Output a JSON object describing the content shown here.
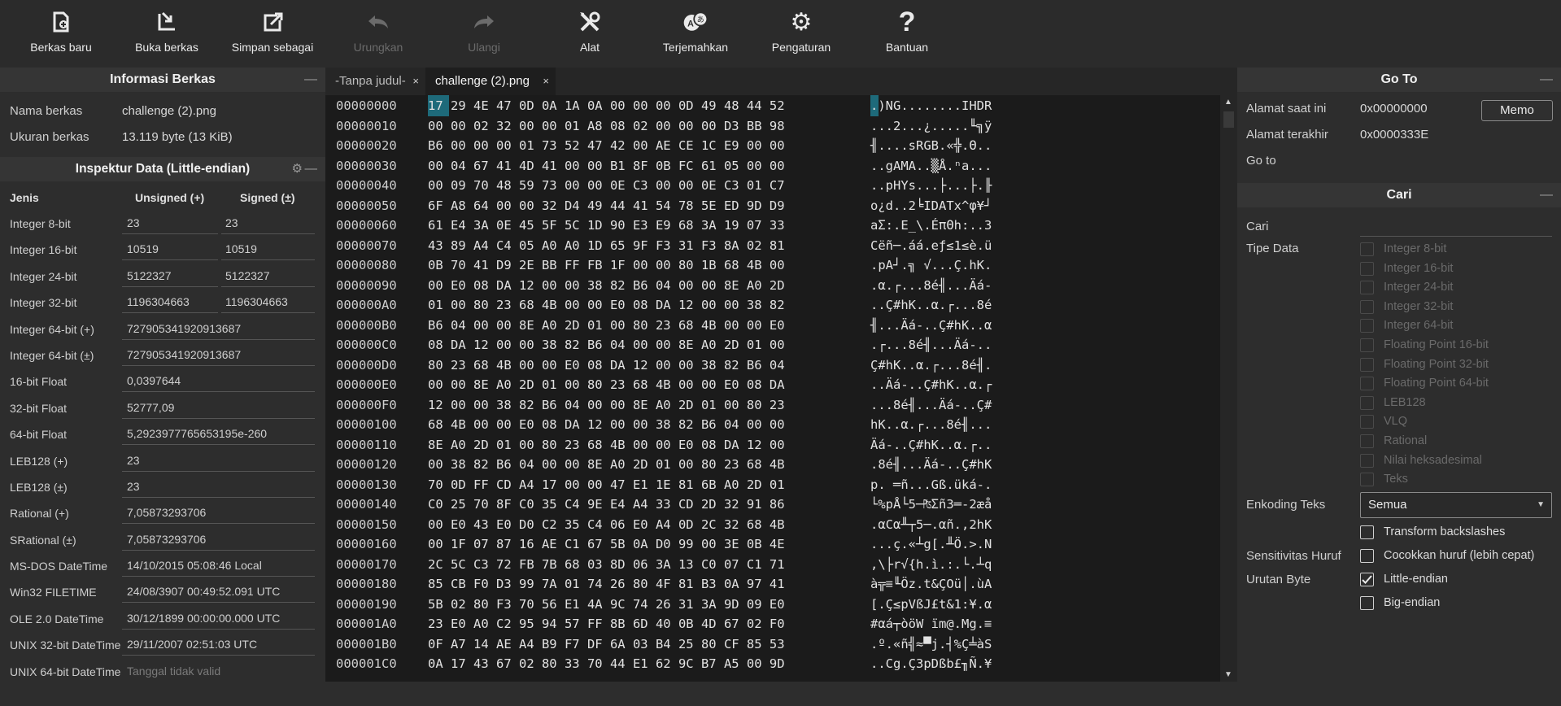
{
  "toolbar": {
    "new_file": "Berkas baru",
    "open_file": "Buka berkas",
    "save_as": "Simpan sebagai",
    "undo": "Urungkan",
    "redo": "Ulangi",
    "tools": "Alat",
    "translate": "Terjemahkan",
    "settings": "Pengaturan",
    "help": "Bantuan"
  },
  "file_info": {
    "title": "Informasi Berkas",
    "name_label": "Nama berkas",
    "name_value": "challenge (2).png",
    "size_label": "Ukuran berkas",
    "size_value": "13.119 byte (13 KiB)"
  },
  "inspector": {
    "title": "Inspektur Data (Little-endian)",
    "col_type": "Jenis",
    "col_unsigned": "Unsigned (+)",
    "col_signed": "Signed (±)",
    "rows": [
      {
        "label": "Integer 8-bit",
        "unsigned": "23",
        "signed": "23"
      },
      {
        "label": "Integer 16-bit",
        "unsigned": "10519",
        "signed": "10519"
      },
      {
        "label": "Integer 24-bit",
        "unsigned": "5122327",
        "signed": "5122327"
      },
      {
        "label": "Integer 32-bit",
        "unsigned": "1196304663",
        "signed": "1196304663"
      }
    ],
    "full_rows": [
      {
        "label": "Integer 64-bit (+)",
        "value": "727905341920913687"
      },
      {
        "label": "Integer 64-bit (±)",
        "value": "727905341920913687"
      },
      {
        "label": "16-bit Float",
        "value": "0,0397644"
      },
      {
        "label": "32-bit Float",
        "value": "52777,09"
      },
      {
        "label": "64-bit Float",
        "value": "5,2923977765653195e-260"
      },
      {
        "label": "LEB128 (+)",
        "value": "23"
      },
      {
        "label": "LEB128 (±)",
        "value": "23"
      },
      {
        "label": "Rational (+)",
        "value": "7,05873293706"
      },
      {
        "label": "SRational (±)",
        "value": "7,05873293706"
      },
      {
        "label": "MS-DOS DateTime",
        "value": "14/10/2015 05:08:46 Local"
      },
      {
        "label": "Win32 FILETIME",
        "value": "24/08/3907 00:49:52.091 UTC"
      },
      {
        "label": "OLE 2.0 DateTime",
        "value": "30/12/1899 00:00:00.000 UTC"
      },
      {
        "label": "UNIX 32-bit DateTime",
        "value": "29/11/2007 02:51:03 UTC"
      },
      {
        "label": "UNIX 64-bit DateTime",
        "value": "Tanggal tidak valid"
      }
    ]
  },
  "tabs": [
    {
      "label": "-Tanpa judul-",
      "close": "×"
    },
    {
      "label": "challenge (2).png",
      "close": "×"
    }
  ],
  "hex": [
    {
      "addr": "00000000",
      "bytes": "17 29 4E 47 0D 0A 1A 0A 00 00 00 0D 49 48 44 52",
      "ascii": ".)NG........IHDR"
    },
    {
      "addr": "00000010",
      "bytes": "00 00 02 32 00 00 01 A8 08 02 00 00 00 D3 BB 98",
      "ascii": "...2...¿.....╙╗ÿ"
    },
    {
      "addr": "00000020",
      "bytes": "B6 00 00 00 01 73 52 47 42 00 AE CE 1C E9 00 00",
      "ascii": "╢....sRGB.«╬.Θ.."
    },
    {
      "addr": "00000030",
      "bytes": "00 04 67 41 4D 41 00 00 B1 8F 0B FC 61 05 00 00",
      "ascii": "..gAMA..▒Å.ⁿa..."
    },
    {
      "addr": "00000040",
      "bytes": "00 09 70 48 59 73 00 00 0E C3 00 00 0E C3 01 C7",
      "ascii": "..pHYs...├...├.╟"
    },
    {
      "addr": "00000050",
      "bytes": "6F A8 64 00 00 32 D4 49 44 41 54 78 5E ED 9D D9",
      "ascii": "o¿d..2╘IDATx^φ¥┘"
    },
    {
      "addr": "00000060",
      "bytes": "61 E4 3A 0E 45 5F 5C 1D 90 E3 E9 68 3A 19 07 33",
      "ascii": "aΣ:.E_\\.ÉπΘh:..3"
    },
    {
      "addr": "00000070",
      "bytes": "43 89 A4 C4 05 A0 A0 1D 65 9F F3 31 F3 8A 02 81",
      "ascii": "Cëñ─.áá.eƒ≤1≤è.ü"
    },
    {
      "addr": "00000080",
      "bytes": "0B 70 41 D9 2E BB FF FB 1F 00 00 80 1B 68 4B 00",
      "ascii": ".pA┘.╗ √...Ç.hK."
    },
    {
      "addr": "00000090",
      "bytes": "00 E0 08 DA 12 00 00 38 82 B6 04 00 00 8E A0 2D",
      "ascii": ".α.┌...8é╢...Äá-"
    },
    {
      "addr": "000000A0",
      "bytes": "01 00 80 23 68 4B 00 00 E0 08 DA 12 00 00 38 82",
      "ascii": "..Ç#hK..α.┌...8é"
    },
    {
      "addr": "000000B0",
      "bytes": "B6 04 00 00 8E A0 2D 01 00 80 23 68 4B 00 00 E0",
      "ascii": "╢...Äá-..Ç#hK..α"
    },
    {
      "addr": "000000C0",
      "bytes": "08 DA 12 00 00 38 82 B6 04 00 00 8E A0 2D 01 00",
      "ascii": ".┌...8é╢...Äá-.."
    },
    {
      "addr": "000000D0",
      "bytes": "80 23 68 4B 00 00 E0 08 DA 12 00 00 38 82 B6 04",
      "ascii": "Ç#hK..α.┌...8é╢."
    },
    {
      "addr": "000000E0",
      "bytes": "00 00 8E A0 2D 01 00 80 23 68 4B 00 00 E0 08 DA",
      "ascii": "..Äá-..Ç#hK..α.┌"
    },
    {
      "addr": "000000F0",
      "bytes": "12 00 00 38 82 B6 04 00 00 8E A0 2D 01 00 80 23",
      "ascii": "...8é╢...Äá-..Ç#"
    },
    {
      "addr": "00000100",
      "bytes": "68 4B 00 00 E0 08 DA 12 00 00 38 82 B6 04 00 00",
      "ascii": "hK..α.┌...8é╢..."
    },
    {
      "addr": "00000110",
      "bytes": "8E A0 2D 01 00 80 23 68 4B 00 00 E0 08 DA 12 00",
      "ascii": "Äá-..Ç#hK..α.┌.."
    },
    {
      "addr": "00000120",
      "bytes": "00 38 82 B6 04 00 00 8E A0 2D 01 00 80 23 68 4B",
      "ascii": ".8é╢...Äá-..Ç#hK"
    },
    {
      "addr": "00000130",
      "bytes": "70 0D FF CD A4 17 00 00 47 E1 1E 81 6B A0 2D 01",
      "ascii": "p. ═ñ...Gß.üká-."
    },
    {
      "addr": "00000140",
      "bytes": "C0 25 70 8F C0 35 C4 9E E4 A4 33 CD 2D 32 91 86",
      "ascii": "└%pÅ└5─₧Σñ3═-2æå"
    },
    {
      "addr": "00000150",
      "bytes": "00 E0 43 E0 D0 C2 35 C4 06 E0 A4 0D 2C 32 68 4B",
      "ascii": ".αCα╨┬5─.αñ.,2hK"
    },
    {
      "addr": "00000160",
      "bytes": "00 1F 07 87 16 AE C1 67 5B 0A D0 99 00 3E 0B 4E",
      "ascii": "...ç.«┴g[.╨Ö.>.N"
    },
    {
      "addr": "00000170",
      "bytes": "2C 5C C3 72 FB 7B 68 03 8D 06 3A 13 C0 07 C1 71",
      "ascii": ",\\├r√{h.ì.:.└.┴q"
    },
    {
      "addr": "00000180",
      "bytes": "85 CB F0 D3 99 7A 01 74 26 80 4F 81 B3 0A 97 41",
      "ascii": "à╦≡╙Öz.t&ÇOü│.ùA"
    },
    {
      "addr": "00000190",
      "bytes": "5B 02 80 F3 70 56 E1 4A 9C 74 26 31 3A 9D 09 E0",
      "ascii": "[.Ç≤pVßJ£t&1:¥.α"
    },
    {
      "addr": "000001A0",
      "bytes": "23 E0 A0 C2 95 94 57 FF 8B 6D 40 0B 4D 67 02 F0",
      "ascii": "#αá┬òöW ïm@.Mg.≡"
    },
    {
      "addr": "000001B0",
      "bytes": "0F A7 14 AE A4 B9 F7 DF 6A 03 B4 25 80 CF 85 53",
      "ascii": ".º.«ñ╣≈▀j.┤%Ç╧àS"
    },
    {
      "addr": "000001C0",
      "bytes": "0A 17 43 67 02 80 33 70 44 E1 62 9C B7 A5 00 9D",
      "ascii": "..Cg.Ç3pDßb£╖Ñ.¥"
    }
  ],
  "goto": {
    "title": "Go To",
    "current_label": "Alamat saat ini",
    "current_value": "0x00000000",
    "memo": "Memo",
    "last_label": "Alamat terakhir",
    "last_value": "0x0000333E",
    "goto_label": "Go to"
  },
  "search": {
    "title": "Cari",
    "find_label": "Cari",
    "type_label": "Tipe Data",
    "types": [
      "Integer 8-bit",
      "Integer 16-bit",
      "Integer 24-bit",
      "Integer 32-bit",
      "Integer 64-bit",
      "Floating Point 16-bit",
      "Floating Point 32-bit",
      "Floating Point 64-bit",
      "LEB128",
      "VLQ",
      "Rational",
      "Nilai heksadesimal",
      "Teks"
    ],
    "encoding_label": "Enkoding Teks",
    "encoding_value": "Semua",
    "transform_label": "Transform backslashes",
    "case_label": "Sensitivitas Huruf",
    "case_option": "Cocokkan huruf (lebih cepat)",
    "byteorder_label": "Urutan Byte",
    "little_endian": "Little-endian",
    "big_endian": "Big-endian"
  },
  "colors": {
    "selection": "#1e6a7a",
    "background": "#262626",
    "panel": "#2d2d2d"
  }
}
